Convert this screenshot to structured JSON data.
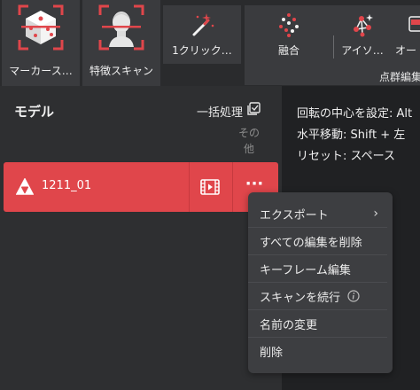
{
  "toolbar": {
    "buttons": [
      {
        "label": "マーカース…",
        "icon": "marker-scan-icon"
      },
      {
        "label": "特徴スキャン",
        "icon": "feature-scan-icon"
      },
      {
        "label": "1クリック…",
        "icon": "magic-wand-icon"
      },
      {
        "label": "融合",
        "icon": "fusion-icon"
      },
      {
        "label": "アイソ…",
        "icon": "isolate-icon"
      },
      {
        "label": "オー",
        "icon": "outlier-icon"
      }
    ],
    "group_label": "点群編集"
  },
  "model_panel": {
    "title": "モデル",
    "batch_label": "一括処理",
    "other_header": "その他",
    "models": [
      {
        "name": "1211_01",
        "icon": "mesh-icon"
      }
    ],
    "more_label": "···"
  },
  "help_panel": {
    "lines": [
      "回転の中心を設定: Alt",
      "水平移動: Shift + 左",
      "リセット: スペース"
    ]
  },
  "context_menu": {
    "items": [
      {
        "label": "エクスポート",
        "has_submenu": true
      },
      {
        "label": "すべての編集を削除"
      },
      {
        "label": "キーフレーム編集"
      },
      {
        "label": "スキャンを続行",
        "has_info": true
      },
      {
        "label": "名前の変更"
      },
      {
        "label": "削除"
      }
    ]
  },
  "colors": {
    "accent": "#e0464b",
    "background": "#2b2c2e",
    "menu": "#3d3e41"
  }
}
